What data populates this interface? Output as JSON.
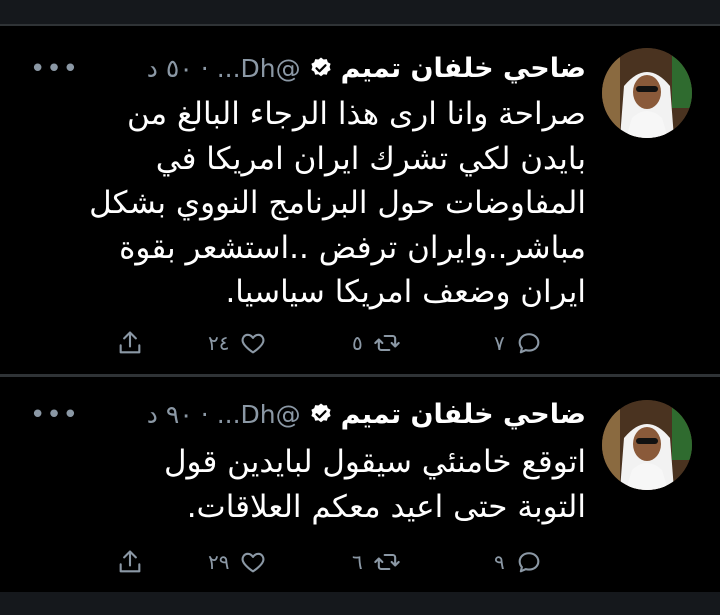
{
  "colors": {
    "background": "#000000",
    "text": "#ffffff",
    "muted": "#8b98a5",
    "verified": "#ffffff",
    "divider": "#2f3336"
  },
  "tweets": [
    {
      "name": "ضاحي خلفان تميم",
      "handle": "@Dh...",
      "dot": "·",
      "time": "٥٠ د",
      "more": "•••",
      "lines": [
        "صراحة وانا ارى هذا الرجاء البالغ من",
        "بايدن لكي تشرك ايران امريكا في",
        "المفاوضات حول البرنامج النووي بشكل",
        "مباشر..وايران ترفض ..استشعر بقوة",
        "ايران وضعف امريكا سياسيا."
      ],
      "replies": "٧",
      "retweets": "٥",
      "likes": "٢٤",
      "icons": [
        "reply-icon",
        "retweet-icon",
        "like-icon",
        "share-icon"
      ]
    },
    {
      "name": "ضاحي خلفان تميم",
      "handle": "@Dh...",
      "dot": "·",
      "time": "٩٠ د",
      "more": "•••",
      "lines": [
        "اتوقع خامنئي سيقول لبايدين قول",
        "التوبة حتى اعيد معكم العلاقات."
      ],
      "replies": "٩",
      "retweets": "٦",
      "likes": "٢٩",
      "icons": [
        "reply-icon",
        "retweet-icon",
        "like-icon",
        "share-icon"
      ]
    }
  ]
}
